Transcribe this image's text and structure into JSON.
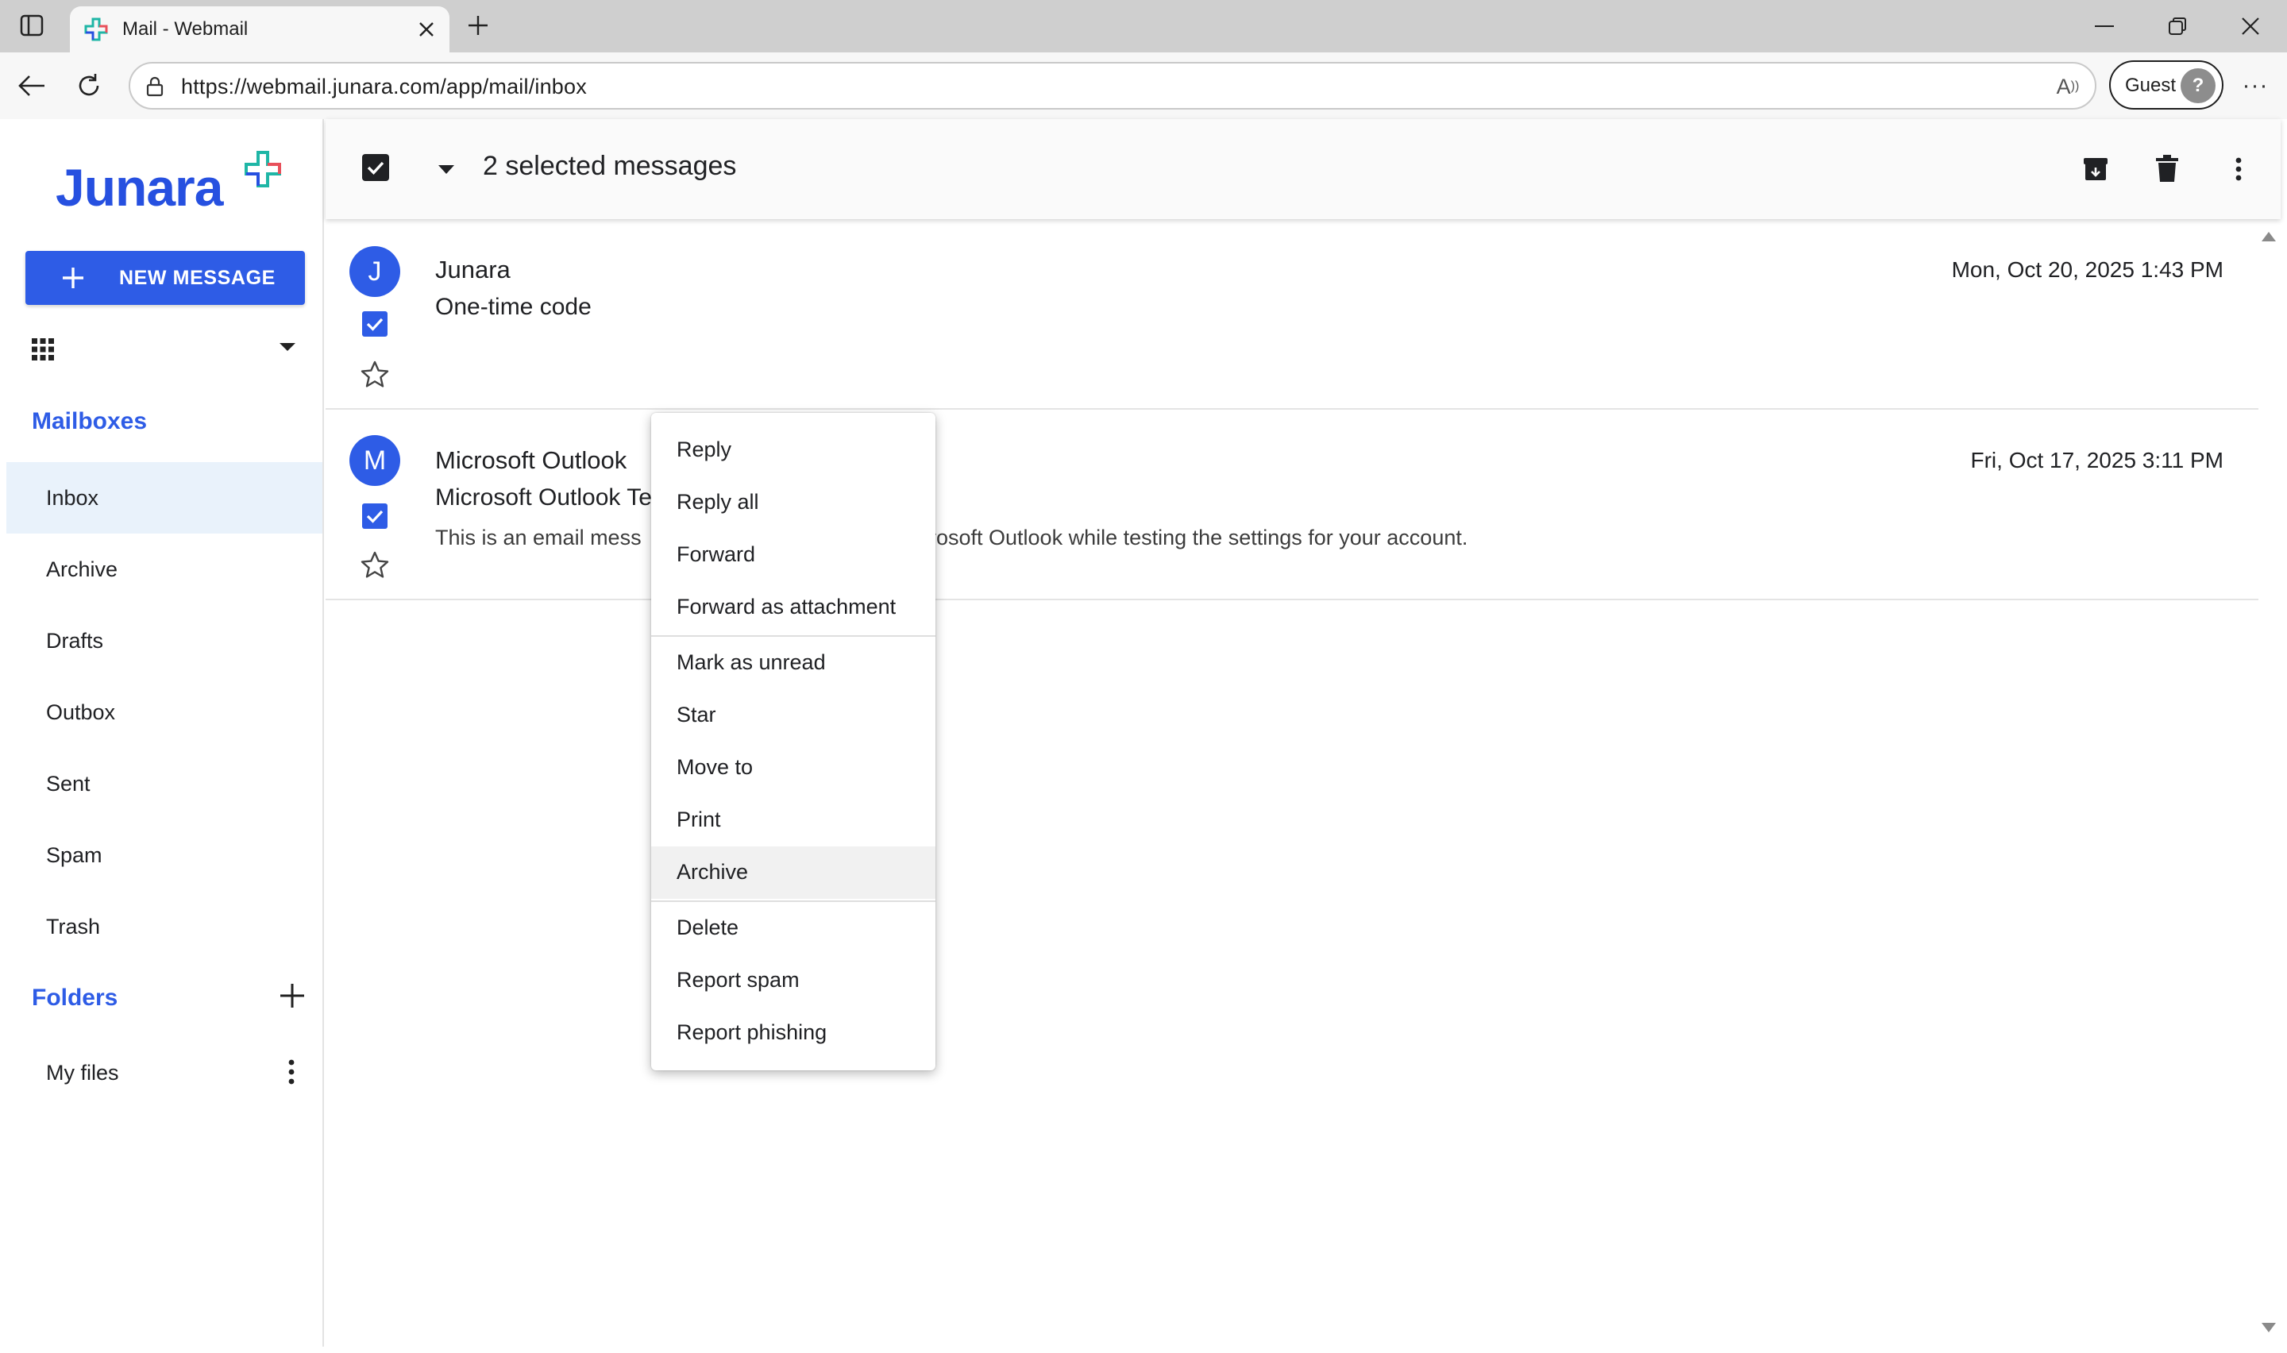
{
  "browser": {
    "tab_title": "Mail - Webmail",
    "url": "https://webmail.junara.com/app/mail/inbox",
    "profile_label": "Guest"
  },
  "sidebar": {
    "logo_text": "Junara",
    "new_message_label": "NEW MESSAGE",
    "mailboxes_heading": "Mailboxes",
    "mailboxes": [
      {
        "label": "Inbox",
        "active": true
      },
      {
        "label": "Archive"
      },
      {
        "label": "Drafts"
      },
      {
        "label": "Outbox"
      },
      {
        "label": "Sent"
      },
      {
        "label": "Spam"
      },
      {
        "label": "Trash"
      }
    ],
    "folders_heading": "Folders",
    "folders": [
      {
        "label": "My files"
      }
    ]
  },
  "selection_bar": {
    "text": "2 selected messages"
  },
  "messages": [
    {
      "avatar": "J",
      "from": "Junara",
      "subject": "One-time code",
      "preview": "",
      "date": "Mon, Oct 20, 2025 1:43 PM",
      "selected": true
    },
    {
      "avatar": "M",
      "from": "Microsoft Outlook",
      "subject": "Microsoft Outlook Te",
      "preview": "This is an email mess",
      "preview_tail": "rosoft Outlook while testing the settings for your account.",
      "date": "Fri, Oct 17, 2025 3:11 PM",
      "selected": true
    }
  ],
  "context_menu": {
    "groups": [
      [
        "Reply",
        "Reply all",
        "Forward",
        "Forward as attachment"
      ],
      [
        "Mark as unread",
        "Star",
        "Move to",
        "Print",
        "Archive"
      ],
      [
        "Delete",
        "Report spam",
        "Report phishing"
      ]
    ],
    "hovered": "Archive"
  },
  "colors": {
    "accent": "#2e5ce6",
    "active_item_bg": "#e9f2fb",
    "hover_bg": "#f1f1f1"
  }
}
